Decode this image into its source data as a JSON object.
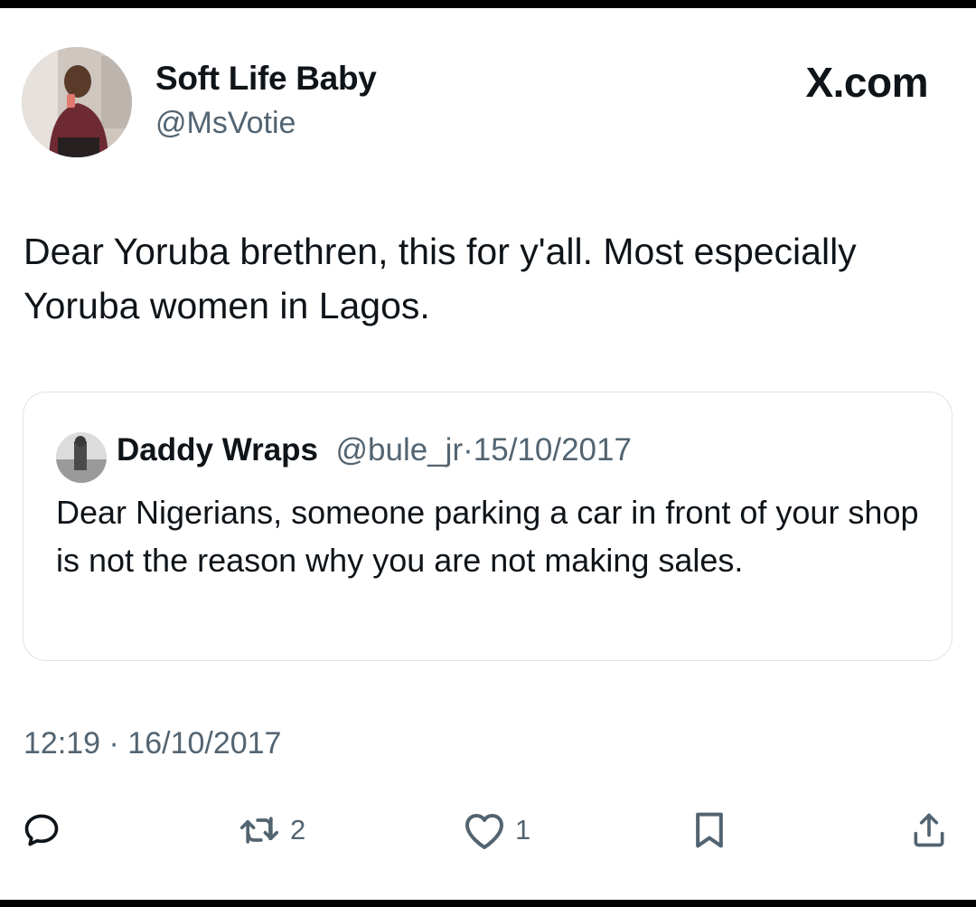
{
  "brand": "X.com",
  "tweet": {
    "author_name": "Soft Life Baby",
    "author_handle": "@MsVotie",
    "text": "Dear Yoruba brethren, this for y'all. Most especially Yoruba women in Lagos.",
    "timestamp": "12:19 · 16/10/2017"
  },
  "quoted_tweet": {
    "author_name": "Daddy Wraps",
    "author_handle": "@bule_jr",
    "date": "15/10/2017",
    "text": "Dear Nigerians, someone parking a car in front of your shop is not the reason why you are not making sales."
  },
  "actions": {
    "reply_icon": "speech-bubble-icon",
    "retweet_icon": "retweet-arrows-icon",
    "retweet_count": "2",
    "like_icon": "heart-icon",
    "like_count": "1",
    "bookmark_icon": "bookmark-icon",
    "share_icon": "share-upload-icon"
  }
}
